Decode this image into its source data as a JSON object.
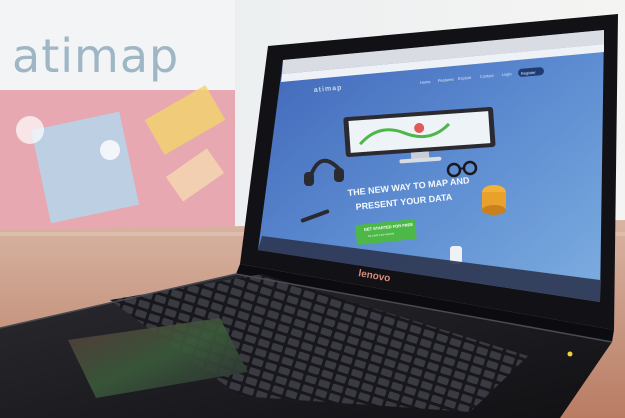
{
  "poster": {
    "text": "atimap"
  },
  "website": {
    "brand": "atimap",
    "nav": [
      "Home",
      "Features",
      "Explore",
      "Contact",
      "Login"
    ],
    "register": "Register",
    "headline_line1": "THE NEW WAY TO MAP AND",
    "headline_line2": "PRESENT YOUR DATA",
    "cta_label": "GET STARTED FOR FREE",
    "cta_sub": "No credit card required"
  },
  "laptop": {
    "brand": "lenovo"
  },
  "colors": {
    "screen_blue": "#4a78c4",
    "cta_green": "#4db848",
    "laptop_body": "#1c1c20",
    "table_wood": "#c9957a"
  }
}
